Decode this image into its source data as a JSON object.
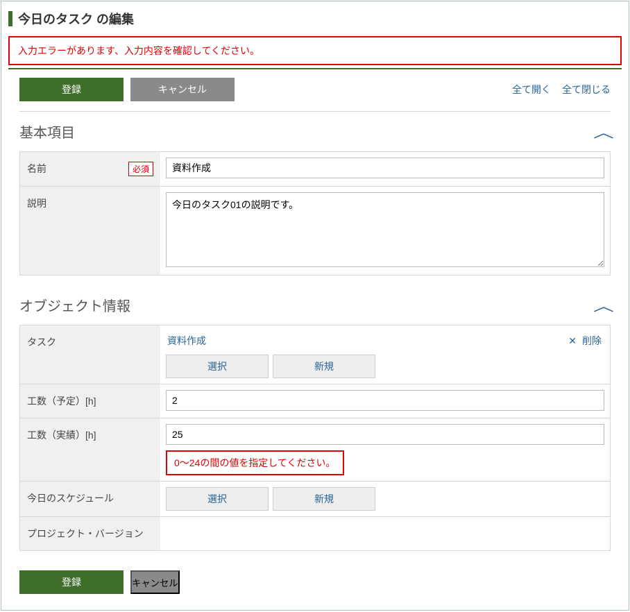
{
  "page": {
    "title": "今日のタスク の編集"
  },
  "errorBanner": "入力エラーがあります、入力内容を確認してください。",
  "buttons": {
    "register": "登録",
    "cancel": "キャンセル",
    "select": "選択",
    "new": "新規"
  },
  "toolbarLinks": {
    "expandAll": "全て開く",
    "collapseAll": "全て閉じる"
  },
  "sections": {
    "basic": {
      "title": "基本項目",
      "fields": {
        "name": {
          "label": "名前",
          "required": "必須",
          "value": "資料作成"
        },
        "description": {
          "label": "説明",
          "value": "今日のタスク01の説明です。"
        }
      }
    },
    "object": {
      "title": "オブジェクト情報",
      "fields": {
        "task": {
          "label": "タスク",
          "linkedItem": "資料作成",
          "deleteLabel": "削除"
        },
        "hoursPlanned": {
          "label": "工数（予定）[h]",
          "value": "2"
        },
        "hoursActual": {
          "label": "工数（実績）[h]",
          "value": "25",
          "error": "0～24の間の値を指定してください。"
        },
        "todaySchedule": {
          "label": "今日のスケジュール"
        },
        "projectVersion": {
          "label": "プロジェクト・バージョン"
        }
      }
    }
  }
}
